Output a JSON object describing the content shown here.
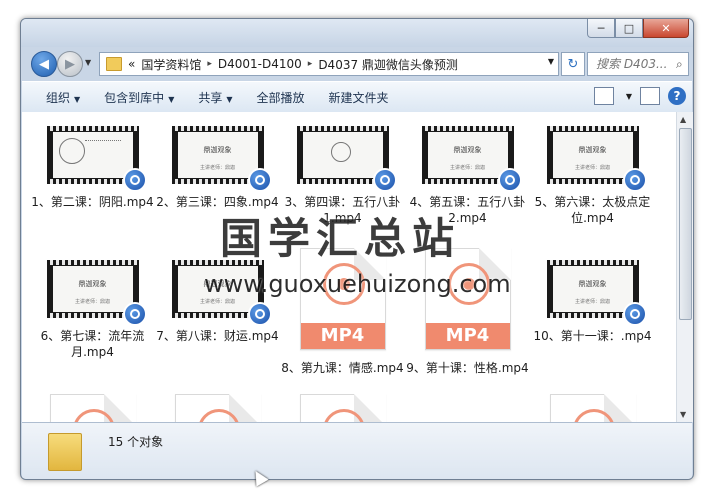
{
  "window": {
    "caption_buttons": {
      "minimize": "─",
      "maximize": "□",
      "close": "✕"
    }
  },
  "nav": {
    "back_icon": "arrow-left",
    "forward_icon": "arrow-right",
    "address_prefix": "«",
    "breadcrumb": [
      "国学资料馆",
      "D4001-D4100",
      "D4037 鼎迦微信头像预测"
    ],
    "breadcrumb_separator": "▸",
    "refresh_icon": "↻",
    "search_placeholder": "搜索 D403..."
  },
  "commands": [
    {
      "label": "组织",
      "dropdown": true
    },
    {
      "label": "包含到库中",
      "dropdown": true
    },
    {
      "label": "共享",
      "dropdown": true
    },
    {
      "label": "全部播放",
      "dropdown": false
    },
    {
      "label": "新建文件夹",
      "dropdown": false
    }
  ],
  "files": [
    {
      "name": "1、第二课：阴阳.mp4",
      "thumb": "diagram"
    },
    {
      "name": "2、第三课：四象.mp4",
      "thumb": "slide",
      "slide_title": "鼎迦观象",
      "slide_sub": "主讲老师：鼎迦"
    },
    {
      "name": "3、第四课：五行八卦1.mp4",
      "thumb": "sketch"
    },
    {
      "name": "4、第五课：五行八卦2.mp4",
      "thumb": "slide",
      "slide_title": "鼎迦观象",
      "slide_sub": "主讲老师：鼎迦"
    },
    {
      "name": "5、第六课：太极点定位.mp4",
      "thumb": "slide",
      "slide_title": "鼎迦观象",
      "slide_sub": "主讲老师：鼎迦"
    },
    {
      "name": "6、第七课：流年流月.mp4",
      "thumb": "slide",
      "slide_title": "鼎迦观象",
      "slide_sub": "主讲老师：鼎迦"
    },
    {
      "name": "7、第八课：财运.mp4",
      "thumb": "slide",
      "slide_title": "鼎迦观象",
      "slide_sub": "主讲老师：鼎迦"
    },
    {
      "name": "8、第九课：情感.mp4",
      "thumb": "mp4",
      "badge": "MP4"
    },
    {
      "name": "9、第十课：性格.mp4",
      "thumb": "mp4",
      "badge": "MP4"
    },
    {
      "name": "10、第十一课：.mp4",
      "thumb": "slide",
      "slide_title": "鼎迦观象",
      "slide_sub": "主讲老师：鼎迦"
    },
    {
      "name": "",
      "thumb": "mp4"
    },
    {
      "name": "",
      "thumb": "mp4"
    },
    {
      "name": "",
      "thumb": "mp4"
    },
    {
      "name": "",
      "thumb": "slide-partial",
      "slide_title": "鼎迦观象"
    },
    {
      "name": "",
      "thumb": "mp4"
    }
  ],
  "watermark": {
    "line1": "国学汇总站",
    "line2": "www.guoxuehuizong.com"
  },
  "status": {
    "count_text": "15 个对象"
  },
  "colors": {
    "mp4_accent": "#f08a6e",
    "play_badge": "#1b4fa8",
    "chrome": "#c9d6e6"
  }
}
